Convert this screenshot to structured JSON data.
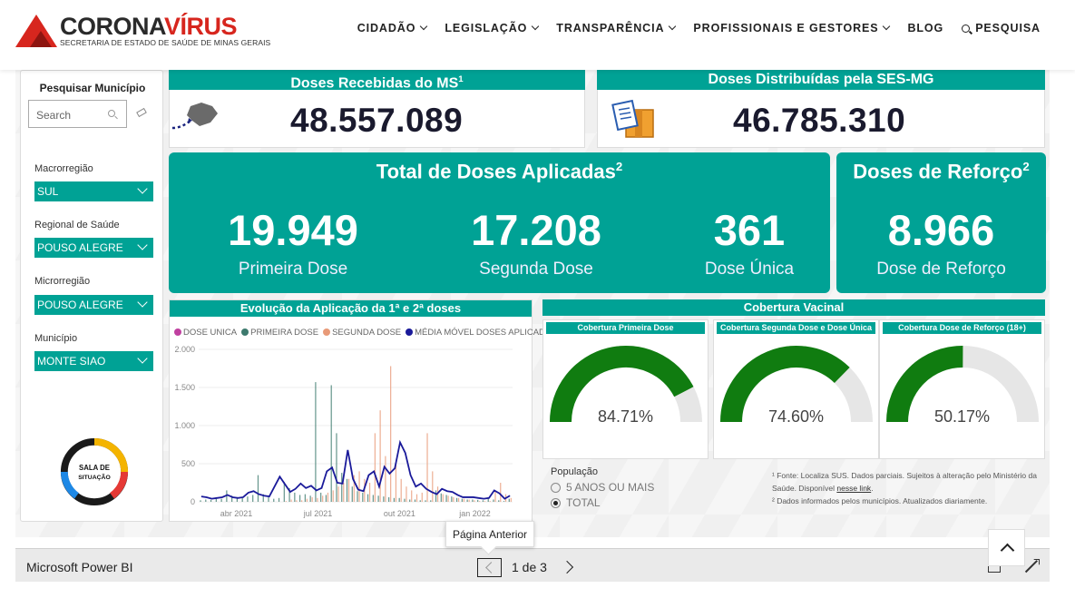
{
  "header": {
    "logo_word_a": "CORONA",
    "logo_word_b": "VÍRUS",
    "logo_subtitle": "SECRETARIA DE ESTADO DE SAÚDE DE MINAS GERAIS",
    "nav": [
      "CIDADÃO",
      "LEGISLAÇÃO",
      "TRANSPARÊNCIA",
      "PROFISSIONAIS E GESTORES",
      "BLOG",
      "PESQUISA"
    ]
  },
  "filters": {
    "title": "Pesquisar Município",
    "search_placeholder": "Search",
    "fields": [
      {
        "label": "Macrorregião",
        "value": "SUL"
      },
      {
        "label": "Regional de Saúde",
        "value": "POUSO ALEGRE"
      },
      {
        "label": "Microrregião",
        "value": "POUSO ALEGRE"
      },
      {
        "label": "Município",
        "value": "MONTE SIAO"
      }
    ],
    "logo_text": "SALA DE SITUAÇÃO"
  },
  "doses_recebidas": {
    "title": "Doses Recebidas do MS",
    "sup": "1",
    "value": "48.557.089"
  },
  "doses_distribuidas": {
    "title": "Doses Distribuídas pela SES-MG",
    "value": "46.785.310"
  },
  "total_aplicadas": {
    "title": "Total de Doses Aplicadas",
    "sup": "2",
    "items": [
      {
        "value": "19.949",
        "label": "Primeira Dose"
      },
      {
        "value": "17.208",
        "label": "Segunda Dose"
      },
      {
        "value": "361",
        "label": "Dose Única"
      }
    ]
  },
  "reforco": {
    "title": "Doses de Reforço",
    "sup": "2",
    "value": "8.966",
    "label": "Dose de Reforço"
  },
  "evolucao": {
    "title": "Evolução da Aplicação da 1ª e 2ª doses",
    "legend": [
      {
        "name": "DOSE UNICA",
        "color": "#c040a0"
      },
      {
        "name": "PRIMEIRA DOSE",
        "color": "#3d7a6e"
      },
      {
        "name": "SEGUNDA DOSE",
        "color": "#e89a78"
      },
      {
        "name": "MÉDIA MÓVEL DOSES APLICAD...",
        "color": "#1a1a9a"
      }
    ]
  },
  "chart_data": {
    "type": "bar",
    "title": "Evolução da Aplicação da 1ª e 2ª doses",
    "ylim": [
      0,
      2000
    ],
    "y_ticks": [
      "2.000",
      "1.500",
      "1.000",
      "500",
      "0"
    ],
    "x_ticks": [
      "abr 2021",
      "jul 2021",
      "out 2021",
      "jan 2022"
    ],
    "series": [
      {
        "name": "PRIMEIRA DOSE",
        "values": [
          20,
          30,
          25,
          60,
          40,
          150,
          80,
          60,
          50,
          70,
          90,
          350,
          100,
          60,
          40,
          50,
          260,
          180,
          120,
          90,
          100,
          80,
          1570,
          120,
          90,
          1530,
          900,
          380,
          300,
          200,
          140,
          120,
          100,
          90,
          80,
          70,
          60,
          50,
          50,
          40,
          30,
          30,
          20,
          20,
          20,
          150,
          110,
          90,
          70,
          50,
          40,
          30,
          30,
          25,
          20,
          60,
          30,
          20,
          10,
          40
        ]
      },
      {
        "name": "SEGUNDA DOSE",
        "values": [
          0,
          0,
          0,
          0,
          0,
          0,
          0,
          0,
          0,
          0,
          0,
          0,
          0,
          0,
          0,
          0,
          10,
          30,
          20,
          20,
          40,
          60,
          50,
          80,
          120,
          150,
          200,
          250,
          300,
          350,
          400,
          300,
          250,
          900,
          1200,
          600,
          1780,
          500,
          300,
          200,
          150,
          100,
          120,
          900,
          400,
          200,
          100,
          80,
          60,
          50,
          40,
          30,
          20,
          10,
          10,
          10,
          150,
          250,
          100,
          50
        ]
      },
      {
        "name": "MÉDIA MÓVEL DOSES APLICADAS",
        "values": [
          70,
          60,
          40,
          50,
          60,
          90,
          60,
          50,
          60,
          120,
          140,
          100,
          80,
          70,
          200,
          330,
          230,
          130,
          170,
          240,
          180,
          210,
          150,
          180,
          400,
          450,
          250,
          240,
          680,
          300,
          160,
          140,
          350,
          400,
          200,
          460,
          370,
          440,
          780,
          640,
          350,
          200,
          240,
          170,
          130,
          100,
          170,
          140,
          130,
          90,
          60,
          60,
          60,
          50,
          40,
          50,
          150,
          110,
          40,
          80
        ]
      }
    ]
  },
  "cobertura": {
    "title": "Cobertura Vacinal",
    "gauges": [
      {
        "title": "Cobertura Primeira Dose",
        "value": 84.71,
        "label": "84.71%"
      },
      {
        "title": "Cobertura Segunda Dose e Dose Única",
        "value": 74.6,
        "label": "74.60%"
      },
      {
        "title": "Cobertura Dose de Reforço (18+)",
        "value": 50.17,
        "label": "50.17%"
      }
    ],
    "gauge_color": "#107c10",
    "track_color": "#e6e6e6"
  },
  "populacao": {
    "title": "População",
    "options": [
      {
        "label": "5 ANOS OU MAIS",
        "selected": false
      },
      {
        "label": "TOTAL",
        "selected": true
      }
    ]
  },
  "notes": {
    "line1": "¹ Fonte: Localiza SUS. Dados parciais. Sujeitos à alteração pelo Ministério da Saúde. Disponível",
    "link": "nesse link",
    "line1_end": ".",
    "line2": "² Dados informados pelos municípios. Atualizados diariamente."
  },
  "powerbi": {
    "name": "Microsoft Power BI",
    "page": "1 de 3",
    "tooltip": "Página Anterior"
  }
}
